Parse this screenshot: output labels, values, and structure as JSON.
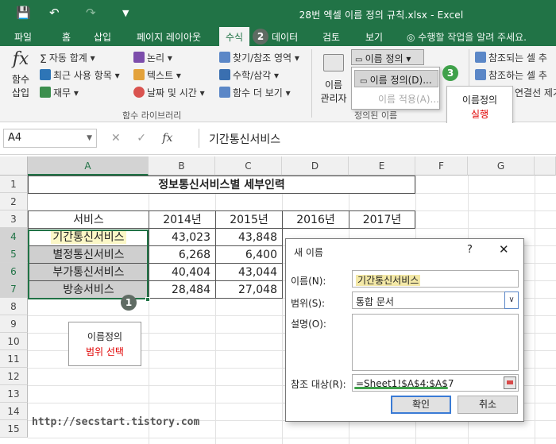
{
  "titlebar": {
    "title": "28번 엑셀 이름 정의 규칙.xlsx - Excel",
    "save_icon": "save-icon",
    "undo_icon": "undo-icon",
    "redo_icon": "redo-icon"
  },
  "tabs": {
    "items": [
      "파일",
      "홈",
      "삽입",
      "페이지 레이아웃",
      "수식",
      "데이터",
      "검토",
      "보기"
    ],
    "active": "수식",
    "tell_me": "수행할 작업을 알려 주세요."
  },
  "ribbon": {
    "insert_function_line1": "함수",
    "insert_function_line2": "삽입",
    "fx_symbol": "fx",
    "lib_items": [
      "자동 합계 ▾",
      "최근 사용 항목 ▾",
      "재무 ▾",
      "논리 ▾",
      "텍스트 ▾",
      "날짜 및 시간 ▾",
      "찾기/참조 영역 ▾",
      "수학/삼각 ▾",
      "함수 더 보기 ▾"
    ],
    "lib_group_label": "함수 라이브러리",
    "name_manager_line1": "이름",
    "name_manager_line2": "관리자",
    "define_name_btn": "이름 정의 ▾",
    "menu_define": "이름 정의(D)...",
    "menu_apply": "이름 적용(A)...",
    "defined_group_label": "정의된 이름",
    "audit_items": [
      "참조되는 셀 추",
      "참조하는 셀 추",
      "연결선 제거"
    ],
    "tooltip_line1": "이름정의",
    "tooltip_line2": "실행"
  },
  "steps": [
    "1",
    "2",
    "3"
  ],
  "formula_bar": {
    "name_box": "A4",
    "cancel": "✕",
    "enter": "✓",
    "fx": "fx",
    "content": "기간통신서비스"
  },
  "sheet": {
    "columns": [
      "A",
      "B",
      "C",
      "D",
      "E",
      "F",
      "G"
    ],
    "rows": [
      "1",
      "2",
      "3",
      "4",
      "5",
      "6",
      "7",
      "8",
      "9",
      "10",
      "11",
      "12",
      "13",
      "14",
      "15"
    ],
    "title": "정보통신서비스별 세부인력",
    "header": [
      "서비스",
      "2014년",
      "2015년",
      "2016년",
      "2017년"
    ],
    "data": [
      [
        "기간통신서비스",
        "43,023",
        "43,848"
      ],
      [
        "별정통신서비스",
        "6,268",
        "6,400"
      ],
      [
        "부가통신서비스",
        "40,404",
        "43,044"
      ],
      [
        "방송서비스",
        "28,484",
        "27,048"
      ]
    ],
    "tip_line1": "이름정의",
    "tip_line2": "범위 선택"
  },
  "dialog": {
    "title": "새 이름",
    "help": "?",
    "close": "✕",
    "name_label": "이름(N):",
    "name_value": "기간통신서비스",
    "scope_label": "범위(S):",
    "scope_value": "통합 문서",
    "comment_label": "설명(O):",
    "ref_label": "참조 대상(R):",
    "ref_value": "=Sheet1!$A$4:$A$7",
    "ok": "확인",
    "cancel": "취소"
  },
  "watermark": "http://secstart.tistory.com",
  "colors": {
    "excel_green": "#217346",
    "step_green": "#3fa14a",
    "highlight_red": "#e00000"
  }
}
